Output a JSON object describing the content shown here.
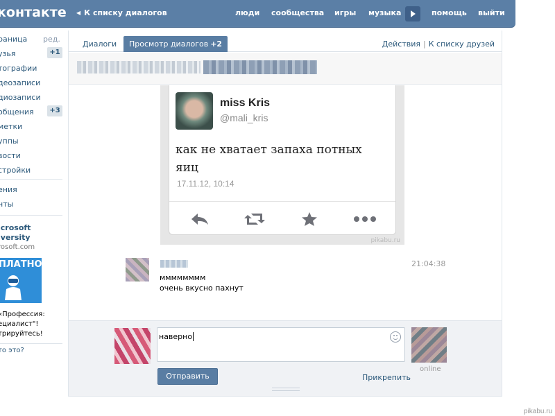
{
  "header": {
    "logo": "контакте",
    "back_link": "К списку диалогов",
    "nav": [
      "люди",
      "сообщества",
      "игры",
      "музыка",
      "помощь",
      "выйти"
    ]
  },
  "sidebar": {
    "edit": "ред.",
    "items": [
      {
        "label": "раница",
        "badge": ""
      },
      {
        "label": "узья",
        "badge": "+1"
      },
      {
        "label": "тографии",
        "badge": ""
      },
      {
        "label": "деозаписи",
        "badge": ""
      },
      {
        "label": "диозаписи",
        "badge": ""
      },
      {
        "label": "общения",
        "badge": "+3"
      },
      {
        "label": "метки",
        "badge": ""
      },
      {
        "label": "уппы",
        "badge": ""
      },
      {
        "label": "вости",
        "badge": ""
      },
      {
        "label": "стройки",
        "badge": ""
      }
    ],
    "extra": [
      "ения",
      "нты"
    ],
    "ad": {
      "title_line1": "icrosoft",
      "title_line2": "iversity",
      "domain": "rosoft.com",
      "badge": "ПЛАТНО",
      "text_line1": "«Профессия:",
      "text_line2": "ециалист\"!",
      "text_line3": "трируйтесь!",
      "what": "то это?"
    }
  },
  "tabs": {
    "dialogs": "Диалоги",
    "view_dialogs": "Просмотр диалогов",
    "view_count": "+2",
    "actions": "Действия",
    "to_friends": "К списку друзей",
    "divider": "|"
  },
  "tweet": {
    "name": "miss Kris",
    "handle": "@mali_kris",
    "text": "как не хватает запаха потных яиц",
    "date": "17.11.12, 10:14",
    "watermark": "pikabu.ru",
    "icons": [
      "reply-icon",
      "retweet-icon",
      "star-icon",
      "more-icon"
    ]
  },
  "message": {
    "time": "21:04:38",
    "line1": "мммммммм",
    "line2": "очень вкусно пахнут"
  },
  "composer": {
    "value": "наверно",
    "send": "Отправить",
    "attach": "Прикрепить",
    "online": "online"
  },
  "watermark": "pikabu.ru",
  "colors": {
    "header": "#5b7fa6",
    "link": "#2b587a",
    "button": "#597da3"
  }
}
